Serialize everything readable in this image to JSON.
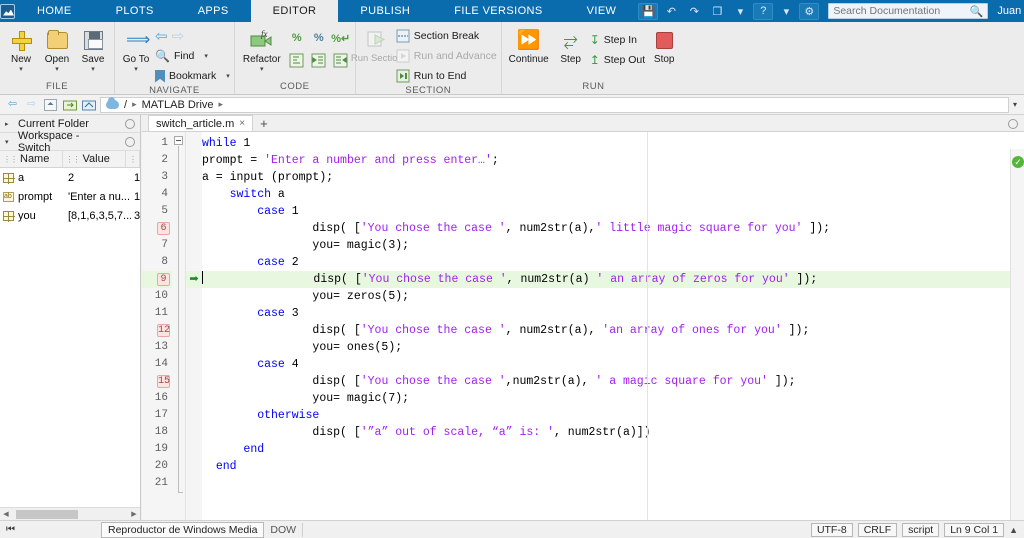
{
  "titlebar": {
    "logo_icon": "matlab-logo-icon",
    "tabs": [
      {
        "label": "HOME",
        "active": false
      },
      {
        "label": "PLOTS",
        "active": false
      },
      {
        "label": "APPS",
        "active": false
      },
      {
        "label": "EDITOR",
        "active": true
      },
      {
        "label": "PUBLISH",
        "active": false
      },
      {
        "label": "FILE VERSIONS",
        "active": false
      },
      {
        "label": "VIEW",
        "active": false
      }
    ],
    "quick_access": [
      {
        "name": "save-quick-icon",
        "glyph": "💾"
      },
      {
        "name": "undo-icon",
        "glyph": "↶"
      },
      {
        "name": "redo-icon",
        "glyph": "↷"
      },
      {
        "name": "switch-window-icon",
        "glyph": "❐"
      },
      {
        "name": "switch-window-caret-icon",
        "glyph": "▾"
      },
      {
        "name": "help-icon",
        "glyph": "?"
      },
      {
        "name": "help-caret-icon",
        "glyph": "▾"
      },
      {
        "name": "preferences-icon",
        "glyph": "⚙"
      }
    ],
    "search": {
      "placeholder": "Search Documentation",
      "value": "",
      "icon": "search-icon"
    },
    "user": {
      "name": "Juan",
      "caret": "▾"
    }
  },
  "ribbon": {
    "groups": [
      {
        "label": "FILE",
        "buttons": [
          {
            "label": "New",
            "icon": "new-file-icon",
            "caret": "▾"
          },
          {
            "label": "Open",
            "icon": "open-folder-icon",
            "caret": "▾"
          },
          {
            "label": "Save",
            "icon": "save-icon",
            "caret": "▾"
          }
        ]
      },
      {
        "label": "NAVIGATE",
        "buttons": [
          {
            "label": "Go To",
            "icon": "go-to-icon",
            "caret": "▾"
          }
        ],
        "rows": [
          {
            "label": "",
            "icon": "back-arrow-icon",
            "icon2": "forward-arrow-icon",
            "disabled": true
          },
          {
            "label": "Find",
            "icon": "find-icon",
            "caret": "▾"
          },
          {
            "label": "Bookmark",
            "icon": "bookmark-icon",
            "caret": "▾"
          }
        ]
      },
      {
        "label": "CODE",
        "buttons": [
          {
            "label": "Refactor",
            "icon": "refactor-icon",
            "caret": "▾"
          }
        ],
        "grid_icons": [
          "comment-icon",
          "uncomment-icon",
          "wrap-comments-icon",
          "smart-indent-icon",
          "increase-indent-icon",
          "decrease-indent-icon"
        ]
      },
      {
        "label": "SECTION",
        "buttons": [
          {
            "label": "Run Section",
            "icon": "run-section-icon",
            "disabled": true
          }
        ],
        "rows": [
          {
            "label": "Section Break",
            "icon": "section-break-icon",
            "disabled": false
          },
          {
            "label": "Run and Advance",
            "icon": "run-and-advance-icon",
            "disabled": true
          },
          {
            "label": "Run to End",
            "icon": "run-to-end-icon",
            "disabled": false
          }
        ]
      },
      {
        "label": "RUN",
        "buttons": [
          {
            "label": "Continue",
            "icon": "continue-icon"
          },
          {
            "label": "Step",
            "icon": "step-icon"
          },
          {
            "label": "Stop",
            "icon": "stop-icon"
          }
        ],
        "rows": [
          {
            "label": "Step In",
            "icon": "step-in-icon"
          },
          {
            "label": "Step Out",
            "icon": "step-out-icon"
          }
        ]
      }
    ],
    "collapse_caret": "⌃"
  },
  "addressbar": {
    "back_icon": "back-arrow-icon",
    "forward_icon": "forward-arrow-icon",
    "up_icon": "up-one-level-icon",
    "browse_icon": "browse-folder-icon",
    "refresh_icon": "refresh-icon",
    "cloud_icon": "matlab-drive-cloud-icon",
    "path": [
      "/",
      "MATLAB Drive"
    ],
    "separator": "▸",
    "dropdown_caret": "▾"
  },
  "left_panels": {
    "current_folder": {
      "title": "Current Folder",
      "tri": "▸",
      "close": "○"
    },
    "workspace": {
      "title": "Workspace - Switch_",
      "tri": "▾",
      "close": "○"
    },
    "table": {
      "headers": [
        "Name",
        "Value",
        ""
      ],
      "rows": [
        {
          "icon": "matrix-variable-icon",
          "name": "a",
          "value": "2",
          "extra": "1"
        },
        {
          "icon": "char-variable-icon",
          "name": "prompt",
          "value": "'Enter a nu...",
          "extra": "1"
        },
        {
          "icon": "matrix-variable-icon",
          "name": "you",
          "value": "[8,1,6,3,5,7...",
          "extra": "3"
        }
      ]
    }
  },
  "editor": {
    "doc_tabs": [
      {
        "label": "switch_article.m",
        "close": "×",
        "active": true
      }
    ],
    "add_tab": "+",
    "panel_close": "○",
    "analyzer_status": {
      "icon": "code-ok-icon",
      "glyph": "✓",
      "color": "#53b63a"
    },
    "current_line": 9,
    "breakpoints": [
      6,
      9,
      12,
      15
    ],
    "execution_arrow_line": 9,
    "lines": [
      {
        "n": 1,
        "tokens": [
          {
            "t": "",
            "v": ""
          },
          {
            "t": "kw",
            "v": "while"
          },
          {
            "t": "",
            "v": " 1"
          }
        ]
      },
      {
        "n": 2,
        "tokens": [
          {
            "t": "",
            "v": "prompt = "
          },
          {
            "t": "str",
            "v": "'Enter a number and press enter…'"
          },
          {
            "t": "",
            "v": ";"
          }
        ]
      },
      {
        "n": 3,
        "tokens": [
          {
            "t": "",
            "v": "a = input (prompt);"
          }
        ]
      },
      {
        "n": 4,
        "tokens": [
          {
            "t": "",
            "v": "    "
          },
          {
            "t": "kw",
            "v": "switch"
          },
          {
            "t": "",
            "v": " a"
          }
        ]
      },
      {
        "n": 5,
        "tokens": [
          {
            "t": "",
            "v": "        "
          },
          {
            "t": "kw",
            "v": "case"
          },
          {
            "t": "",
            "v": " 1"
          }
        ]
      },
      {
        "n": 6,
        "tokens": [
          {
            "t": "",
            "v": "                disp( ["
          },
          {
            "t": "str",
            "v": "'You chose the case '"
          },
          {
            "t": "",
            "v": ", num2str(a),"
          },
          {
            "t": "str",
            "v": "' little magic square for you'"
          },
          {
            "t": "",
            "v": " ]);"
          }
        ]
      },
      {
        "n": 7,
        "tokens": [
          {
            "t": "",
            "v": "                you= magic(3);"
          }
        ]
      },
      {
        "n": 8,
        "tokens": [
          {
            "t": "",
            "v": "        "
          },
          {
            "t": "kw",
            "v": "case"
          },
          {
            "t": "",
            "v": " 2"
          }
        ]
      },
      {
        "n": 9,
        "tokens": [
          {
            "t": "",
            "v": "                disp( ["
          },
          {
            "t": "str",
            "v": "'You chose the case '"
          },
          {
            "t": "",
            "v": ", num2str(a) "
          },
          {
            "t": "str",
            "v": "' an array of zeros for you'"
          },
          {
            "t": "",
            "v": " ]);"
          }
        ]
      },
      {
        "n": 10,
        "tokens": [
          {
            "t": "",
            "v": "                you= zeros(5);"
          }
        ]
      },
      {
        "n": 11,
        "tokens": [
          {
            "t": "",
            "v": "        "
          },
          {
            "t": "kw",
            "v": "case"
          },
          {
            "t": "",
            "v": " 3"
          }
        ]
      },
      {
        "n": 12,
        "tokens": [
          {
            "t": "",
            "v": "                disp( ["
          },
          {
            "t": "str",
            "v": "'You chose the case '"
          },
          {
            "t": "",
            "v": ", num2str(a), "
          },
          {
            "t": "str",
            "v": "'an array of ones for you'"
          },
          {
            "t": "",
            "v": " ]);"
          }
        ]
      },
      {
        "n": 13,
        "tokens": [
          {
            "t": "",
            "v": "                you= ones(5);"
          }
        ]
      },
      {
        "n": 14,
        "tokens": [
          {
            "t": "",
            "v": "        "
          },
          {
            "t": "kw",
            "v": "case"
          },
          {
            "t": "",
            "v": " 4"
          }
        ]
      },
      {
        "n": 15,
        "tokens": [
          {
            "t": "",
            "v": "                disp( ["
          },
          {
            "t": "str",
            "v": "'You chose the case '"
          },
          {
            "t": "",
            "v": ",num2str(a), "
          },
          {
            "t": "str",
            "v": "' a magic square for you'"
          },
          {
            "t": "",
            "v": " ]);"
          }
        ]
      },
      {
        "n": 16,
        "tokens": [
          {
            "t": "",
            "v": "                you= magic(7);"
          }
        ]
      },
      {
        "n": 17,
        "tokens": [
          {
            "t": "",
            "v": "        "
          },
          {
            "t": "kw",
            "v": "otherwise"
          }
        ]
      },
      {
        "n": 18,
        "tokens": [
          {
            "t": "",
            "v": "                disp( ["
          },
          {
            "t": "str",
            "v": "'”a” out of scale, “a” is: '"
          },
          {
            "t": "",
            "v": ", num2str(a)])"
          }
        ]
      },
      {
        "n": 19,
        "tokens": [
          {
            "t": "",
            "v": "      "
          },
          {
            "t": "kw",
            "v": "end"
          }
        ]
      },
      {
        "n": 20,
        "tokens": [
          {
            "t": "",
            "v": "  "
          },
          {
            "t": "kw",
            "v": "end"
          }
        ]
      },
      {
        "n": 21,
        "tokens": [
          {
            "t": "",
            "v": ""
          }
        ]
      }
    ]
  },
  "statusbar": {
    "start_icon": "start-menu-icon",
    "taskbar_item": "Reproductor de Windows Media",
    "taskbar_item_behind": "DOW",
    "encoding": "UTF-8",
    "line_ending": "CRLF",
    "file_type": "script",
    "position": "Ln 9 Col 1",
    "expand_icon": "▲"
  }
}
